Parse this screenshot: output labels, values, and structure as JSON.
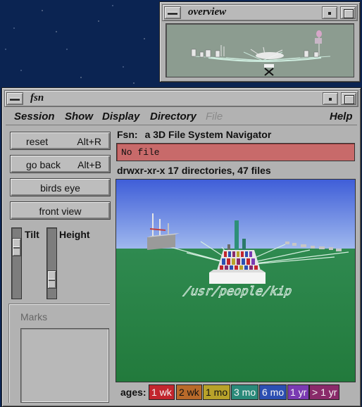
{
  "overview_window": {
    "title": "overview"
  },
  "fsn_window": {
    "title": "fsn",
    "menu": [
      {
        "label": "Session",
        "enabled": true
      },
      {
        "label": "Show",
        "enabled": true
      },
      {
        "label": "Display",
        "enabled": true
      },
      {
        "label": "Directory",
        "enabled": true
      },
      {
        "label": "File",
        "enabled": false
      },
      {
        "label": "Help",
        "enabled": true
      }
    ],
    "buttons": {
      "reset": {
        "label": "reset",
        "accel": "Alt+R"
      },
      "go_back": {
        "label": "go back",
        "accel": "Alt+B"
      },
      "birds_eye": {
        "label": "birds eye"
      },
      "front_view": {
        "label": "front view"
      }
    },
    "sliders": {
      "tilt_label": "Tilt",
      "height_label": "Height"
    },
    "marks_label": "Marks",
    "header": {
      "app_name": "Fsn:",
      "app_desc": "a 3D File System Navigator"
    },
    "file_field": "No file",
    "dir_info": "drwxr-xr-x 17 directories, 47 files",
    "scene_path_label": "/usr/people/kip",
    "ages_label": "ages:",
    "ages": [
      {
        "label": "1 wk",
        "bg": "#c2262e",
        "fg": "#f4f4f4"
      },
      {
        "label": "2 wk",
        "bg": "#b86a2a",
        "fg": "#111111"
      },
      {
        "label": "1 mo",
        "bg": "#b8a22a",
        "fg": "#111111"
      },
      {
        "label": "3 mo",
        "bg": "#2a8a7a",
        "fg": "#f4f4f4"
      },
      {
        "label": "6 mo",
        "bg": "#2c4fb2",
        "fg": "#f4f4f4"
      },
      {
        "label": "1 yr",
        "bg": "#7a3ab2",
        "fg": "#f4f4f4"
      },
      {
        "label": "> 1 yr",
        "bg": "#8a2a6a",
        "fg": "#f4f4f4"
      }
    ]
  }
}
